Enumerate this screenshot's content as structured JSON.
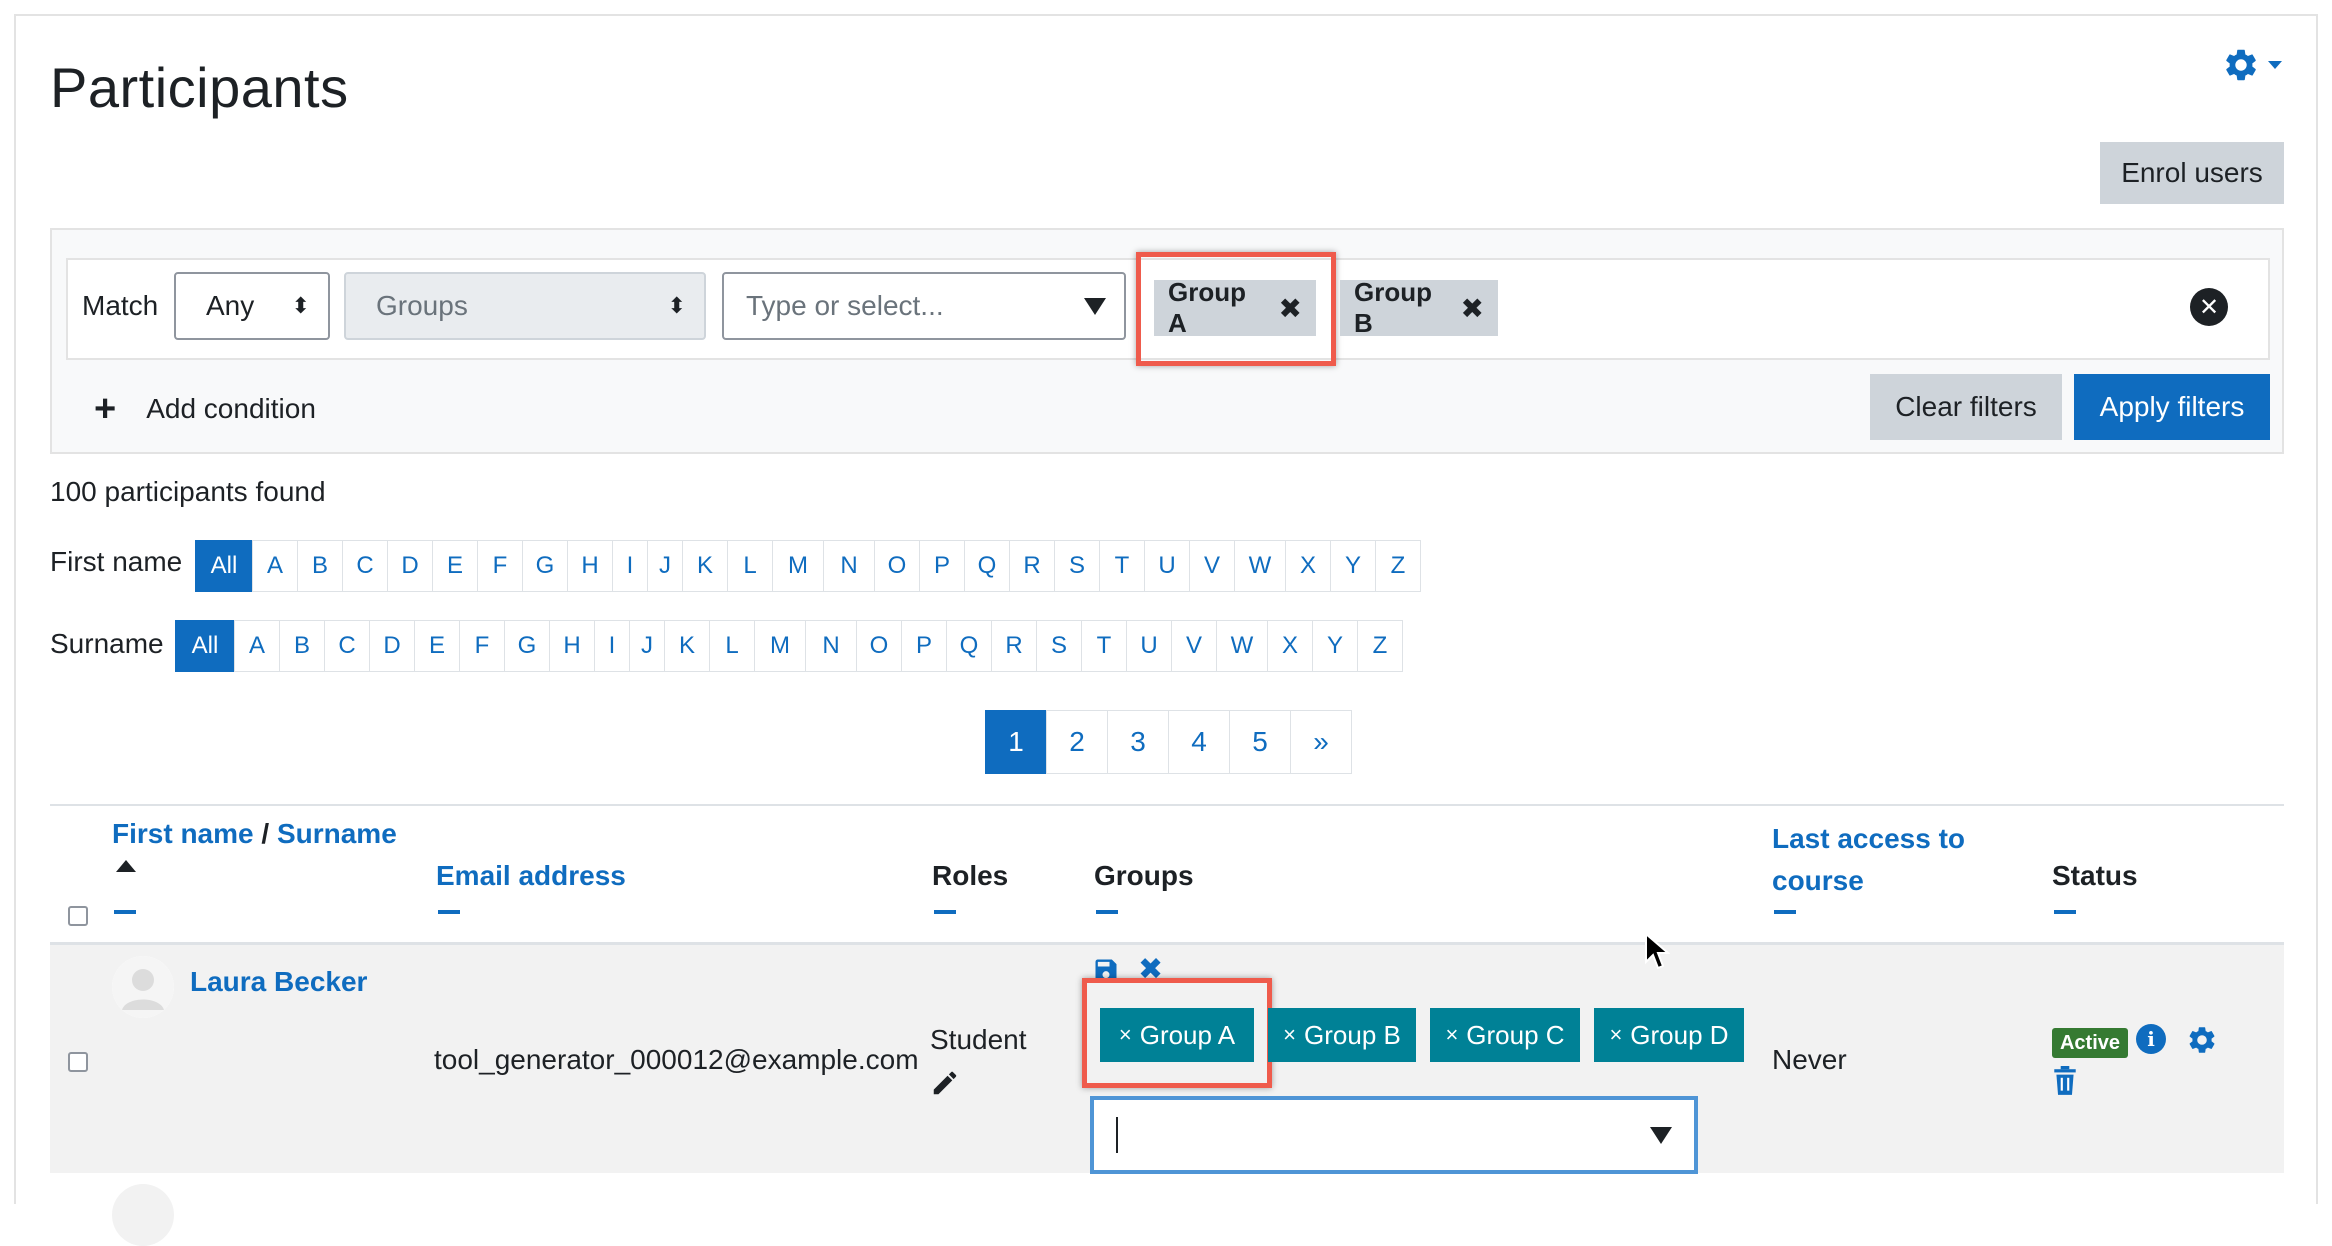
{
  "page": {
    "title": "Participants"
  },
  "header": {
    "enrol_label": "Enrol users"
  },
  "filter": {
    "match_label": "Match",
    "match_value": "Any",
    "type_value": "Groups",
    "value_placeholder": "Type or select...",
    "selected": [
      "Group A",
      "Group B"
    ],
    "chip_remove": "✖",
    "add_condition": "Add condition",
    "clear_label": "Clear filters",
    "apply_label": "Apply filters"
  },
  "summary": {
    "found": "100 participants found"
  },
  "initials": {
    "firstname_label": "First name",
    "surname_label": "Surname",
    "all_label": "All",
    "letters": [
      "A",
      "B",
      "C",
      "D",
      "E",
      "F",
      "G",
      "H",
      "I",
      "J",
      "K",
      "L",
      "M",
      "N",
      "O",
      "P",
      "Q",
      "R",
      "S",
      "T",
      "U",
      "V",
      "W",
      "X",
      "Y",
      "Z"
    ]
  },
  "pagination": {
    "pages": [
      "1",
      "2",
      "3",
      "4",
      "5"
    ],
    "next": "»",
    "current": "1"
  },
  "table": {
    "headers": {
      "firstname": "First name",
      "separator": "/",
      "surname": "Surname",
      "email": "Email address",
      "roles": "Roles",
      "groups": "Groups",
      "last_access_line1": "Last access to",
      "last_access_line2": "course",
      "status": "Status"
    },
    "rows": [
      {
        "name": "Laura Becker",
        "email": "tool_generator_000012@example.com",
        "role": "Student",
        "groups": [
          "Group A",
          "Group B",
          "Group C",
          "Group D"
        ],
        "group_remove": "×",
        "last_access": "Never",
        "status": "Active"
      }
    ]
  },
  "icons": {
    "gear": "gear-icon",
    "close": "times-circle-icon",
    "plus": "plus-icon",
    "sort": "caret-up-icon",
    "edit": "pencil-icon",
    "save": "save-icon",
    "info": "info-icon",
    "delete": "trash-icon",
    "dropdown": "triangle-down-icon"
  },
  "colors": {
    "primary": "#0f6cbf",
    "group_chip": "#008196",
    "active_badge": "#357a32",
    "highlight": "#ef5b4c",
    "focus_border": "#4f95d6"
  }
}
